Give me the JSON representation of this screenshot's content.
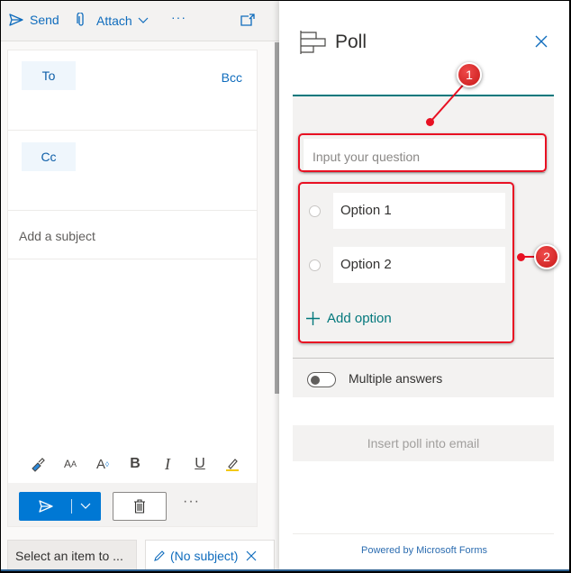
{
  "toolbar": {
    "send_label": "Send",
    "attach_label": "Attach",
    "more_label": "···"
  },
  "compose": {
    "to_label": "To",
    "bcc_label": "Bcc",
    "cc_label": "Cc",
    "subject_placeholder": "Add a subject",
    "more_label": "···"
  },
  "tabs": [
    {
      "label": "Select an item to ..."
    },
    {
      "label": "(No subject)"
    }
  ],
  "poll": {
    "title": "Poll",
    "question_placeholder": "Input your question",
    "options": [
      {
        "label": "Option 1"
      },
      {
        "label": "Option 2"
      }
    ],
    "add_option_label": "Add option",
    "multiple_answers_label": "Multiple answers",
    "multiple_answers_enabled": false,
    "insert_label": "Insert poll into email",
    "powered_by": "Powered by Microsoft Forms"
  },
  "callouts": [
    {
      "number": "1",
      "target": "question-input"
    },
    {
      "number": "2",
      "target": "options-list"
    }
  ],
  "colors": {
    "accent_blue": "#0078d4",
    "teal": "#03787c",
    "callout_red": "#e81123"
  }
}
